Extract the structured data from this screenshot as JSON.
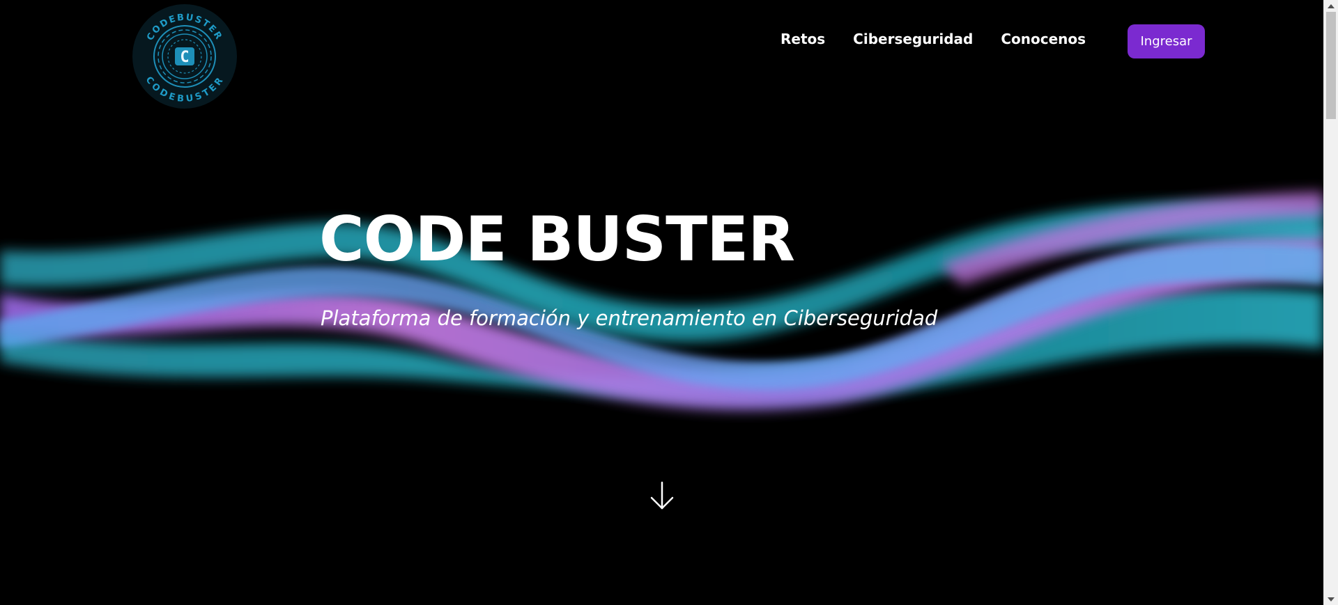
{
  "logo": {
    "text_top": "CODEBUSTER",
    "text_bottom": "CODEBUSTER",
    "glyph": "C",
    "icon": "codebuster-logo-icon"
  },
  "nav": {
    "items": [
      {
        "label": "Retos"
      },
      {
        "label": "Ciberseguridad"
      },
      {
        "label": "Conocenos"
      }
    ],
    "login_label": "Ingresar"
  },
  "hero": {
    "title": "CODE BUSTER",
    "subtitle": "Plataforma de formación y entrenamiento en Ciberseguridad",
    "scroll_icon": "arrow-down-icon"
  },
  "colors": {
    "background": "#000000",
    "accent": "#7b2ad0",
    "wave_cyan": "#1fb3c0",
    "wave_pink": "#c77be6",
    "wave_blue": "#5fa8ef",
    "logo_ring": "#1e8fb8"
  }
}
